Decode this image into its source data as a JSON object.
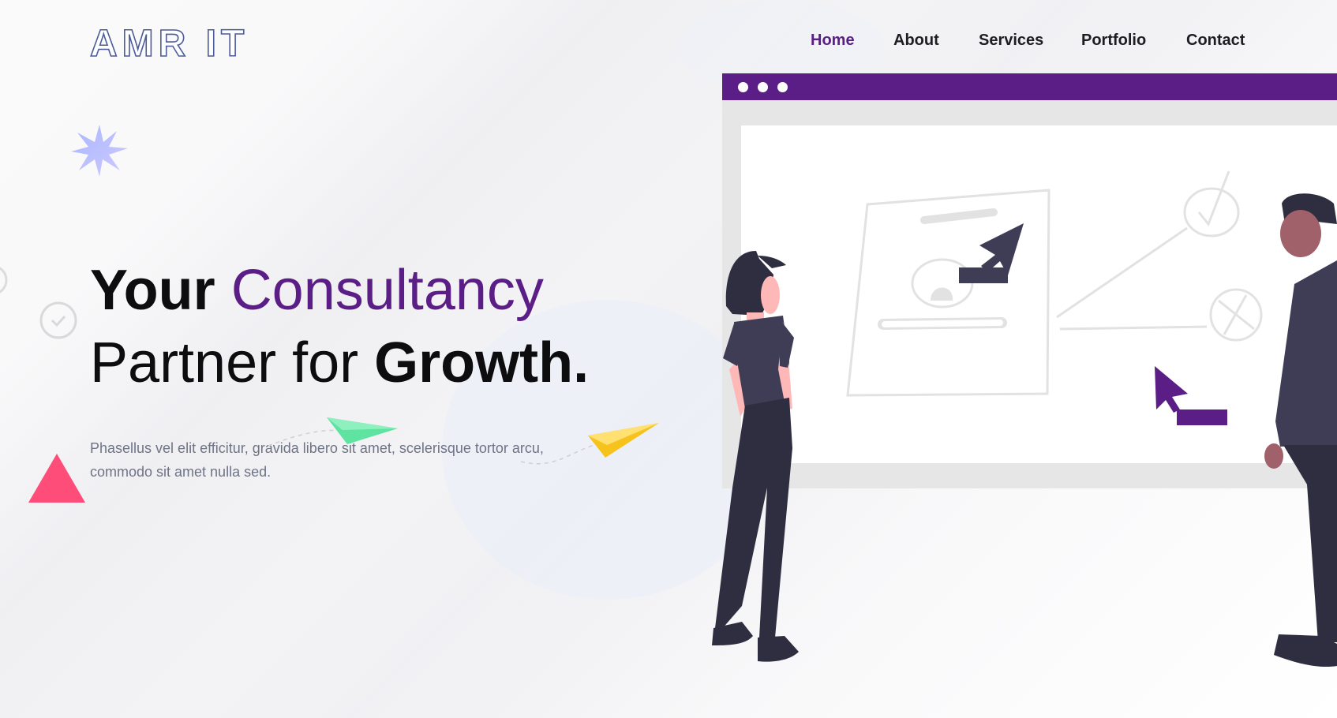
{
  "brand": {
    "logo_text": "AMR IT"
  },
  "nav": {
    "items": [
      {
        "label": "Home",
        "active": true
      },
      {
        "label": "About",
        "active": false
      },
      {
        "label": "Services",
        "active": false
      },
      {
        "label": "Portfolio",
        "active": false
      },
      {
        "label": "Contact",
        "active": false
      }
    ]
  },
  "hero": {
    "title_word1": "Your",
    "title_word2": "Consultancy",
    "title_line2_normal": "Partner for",
    "title_line2_bold": "Growth.",
    "description": "Phasellus vel elit efficitur, gravida libero sit amet, scelerisque tortor arcu, commodo sit amet nulla sed."
  },
  "colors": {
    "accent": "#5b1e86",
    "text_dark": "#0d0d10",
    "text_muted": "#6e7386",
    "triangle": "#ff4d7a",
    "plane_green": "#5fe3a1",
    "plane_yellow": "#f6c21c",
    "figure_dark": "#2f2e41",
    "skin": "#ffb8b8"
  },
  "icons": [
    "starburst-icon",
    "clock-icon",
    "triangle-icon",
    "paper-plane-icon",
    "cursor-icon"
  ]
}
